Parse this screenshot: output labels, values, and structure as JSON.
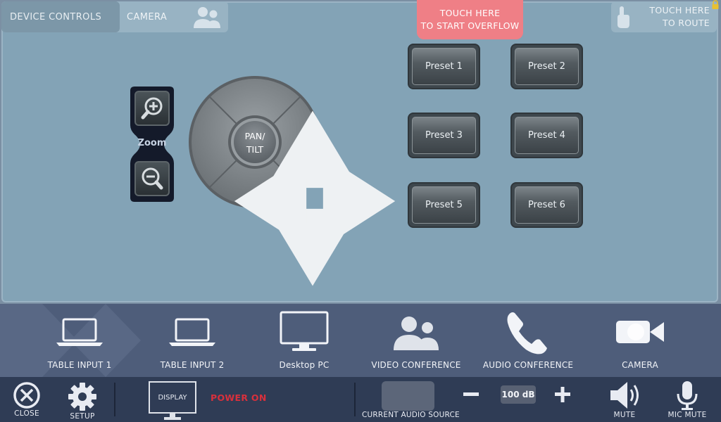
{
  "tabs": {
    "device_controls": "DEVICE CONTROLS",
    "camera": "CAMERA"
  },
  "overflow": {
    "line1": "TOUCH HERE",
    "line2": "TO START OVERFLOW"
  },
  "route": {
    "line1": "TOUCH HERE",
    "line2": "TO ROUTE"
  },
  "zoom": {
    "label": "Zoom"
  },
  "dpad": {
    "center_line1": "PAN/",
    "center_line2": "TILT"
  },
  "presets": [
    "Preset 1",
    "Preset 2",
    "Preset 3",
    "Preset 4",
    "Preset 5",
    "Preset 6"
  ],
  "sources": [
    {
      "label": "TABLE INPUT 1",
      "icon": "laptop-icon"
    },
    {
      "label": "TABLE INPUT 2",
      "icon": "laptop-icon"
    },
    {
      "label": "Desktop PC",
      "icon": "monitor-icon"
    },
    {
      "label": "VIDEO CONFERENCE",
      "icon": "people-icon"
    },
    {
      "label": "AUDIO CONFERENCE",
      "icon": "phone-icon"
    },
    {
      "label": "CAMERA",
      "icon": "video-camera-icon"
    }
  ],
  "bottom": {
    "close": "CLOSE",
    "setup": "SETUP",
    "display": "DISPLAY",
    "power_status": "POWER ON",
    "current_audio_source": "CURRENT AUDIO SOURCE",
    "volume_level": "100 dB",
    "mute": "MUTE",
    "mic_mute": "MIC MUTE"
  },
  "colors": {
    "panel": "#83a3b6",
    "overflow_button": "#ef7f86",
    "source_bar": "#4e5d7a",
    "bottom_bar": "#2f3c55",
    "power_on": "#d8303c"
  }
}
